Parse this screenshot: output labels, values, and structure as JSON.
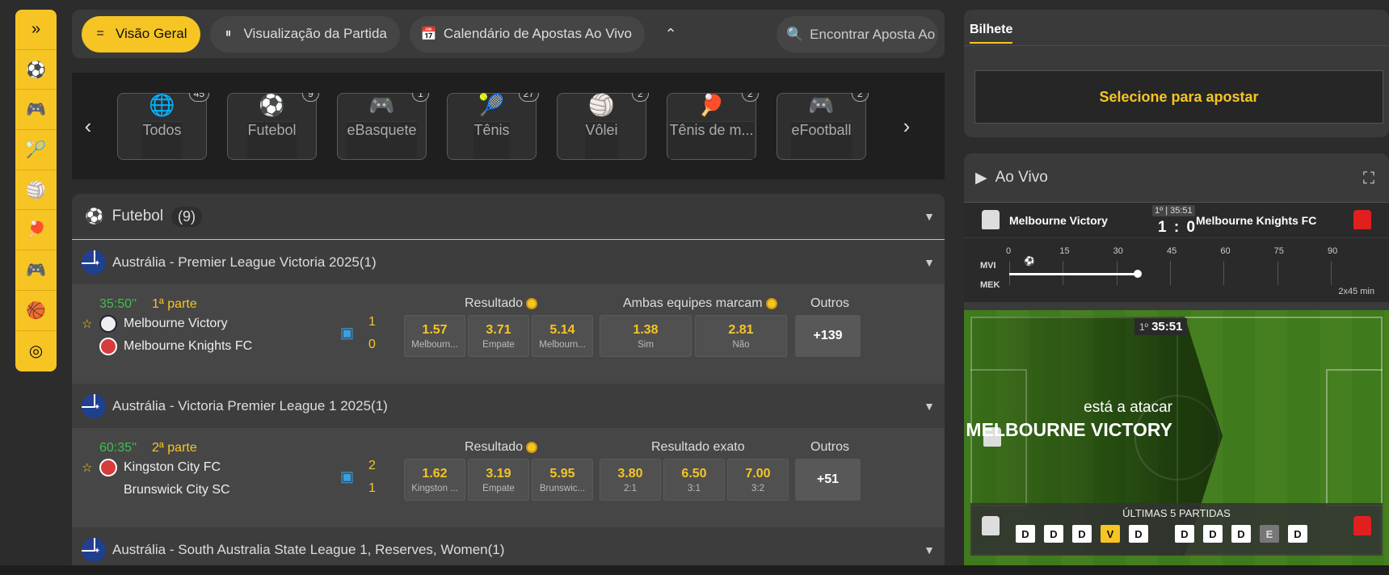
{
  "rail": {
    "items": [
      "»",
      "⚽",
      "🎮",
      "🏸",
      "🏐",
      "🏓",
      "🎮",
      "🏀",
      "◎"
    ]
  },
  "nav": {
    "tabs": [
      {
        "label": "Visão Geral",
        "icon": "="
      },
      {
        "label": "Visualização da Partida",
        "icon": "⏸"
      },
      {
        "label": "Calendário de Apostas Ao Vivo",
        "icon": "📅"
      }
    ],
    "search_placeholder": "Encontrar Aposta Ao Vivo"
  },
  "sports": [
    {
      "label": "Todos",
      "count": "45",
      "icon": "🌐"
    },
    {
      "label": "Futebol",
      "count": "9",
      "icon": "⚽"
    },
    {
      "label": "eBasquete",
      "count": "1",
      "icon": "🎮"
    },
    {
      "label": "Tênis",
      "count": "27",
      "icon": "🎾"
    },
    {
      "label": "Vôlei",
      "count": "2",
      "icon": "🏐"
    },
    {
      "label": "Tênis de m...",
      "count": "2",
      "icon": "🏓"
    },
    {
      "label": "eFootball",
      "count": "2",
      "icon": "🎮"
    }
  ],
  "section": {
    "title": "Futebol",
    "count": "(9)"
  },
  "leagues": [
    {
      "name": "Austrália - Premier League Victoria 2025(1)"
    },
    {
      "name": "Austrália - Victoria Premier League 1 2025(1)"
    },
    {
      "name": "Austrália - South Australia State League 1, Reserves, Women(1)"
    }
  ],
  "matches": [
    {
      "time": "35:50''",
      "period": "1ª parte",
      "home": "Melbourne Victory",
      "away": "Melbourne Knights FC",
      "home_score": "1",
      "away_score": "0",
      "market1": "Resultado",
      "market2": "Ambas equipes marcam",
      "odds1": [
        {
          "v": "1.57",
          "l": "Melbourn..."
        },
        {
          "v": "3.71",
          "l": "Empate"
        },
        {
          "v": "5.14",
          "l": "Melbourn..."
        }
      ],
      "odds2": [
        {
          "v": "1.38",
          "l": "Sim"
        },
        {
          "v": "2.81",
          "l": "Não"
        }
      ],
      "others_label": "Outros",
      "more": "+139"
    },
    {
      "time": "60:35''",
      "period": "2ª parte",
      "home": "Kingston City FC",
      "away": "Brunswick City SC",
      "home_score": "2",
      "away_score": "1",
      "market1": "Resultado",
      "market2": "Resultado exato",
      "odds1": [
        {
          "v": "1.62",
          "l": "Kingston ..."
        },
        {
          "v": "3.19",
          "l": "Empate"
        },
        {
          "v": "5.95",
          "l": "Brunswic..."
        }
      ],
      "odds2": [
        {
          "v": "3.80",
          "l": "2:1"
        },
        {
          "v": "6.50",
          "l": "3:1"
        },
        {
          "v": "7.00",
          "l": "3:2"
        }
      ],
      "others_label": "Outros",
      "more": "+51"
    }
  ],
  "bilhete": {
    "tab": "Bilhete",
    "prompt": "Selecione para apostar"
  },
  "live": {
    "title": "Ao Vivo",
    "home": "Melbourne Victory",
    "away": "Melbourne Knights FC",
    "period": "1º",
    "clock": "35:51",
    "score": "1 : 0",
    "home_abbr": "MVI",
    "away_abbr": "MEK",
    "ticks": [
      "0",
      "15",
      "30",
      "45",
      "60",
      "75",
      "90"
    ],
    "elapsed_minutes": 35.85,
    "duration": "2x45 min",
    "attack_label": "está a atacar",
    "attack_team": "MELBOURNE VICTORY",
    "last5_title": "ÚLTIMAS 5 PARTIDAS",
    "home_last5": [
      "D",
      "D",
      "D",
      "V",
      "D"
    ],
    "away_last5": [
      "D",
      "D",
      "D",
      "E",
      "D"
    ]
  },
  "colors": {
    "accent": "#f6c524",
    "live_time": "#3fbf4d",
    "bg": "#2c2c2c"
  }
}
